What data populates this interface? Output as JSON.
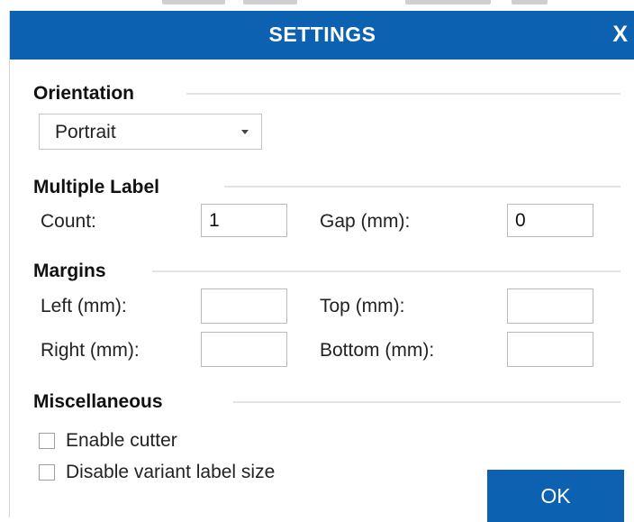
{
  "dialog": {
    "title": "SETTINGS",
    "close_label": "X",
    "accent_color": "#0c61b0"
  },
  "orientation": {
    "heading": "Orientation",
    "selected": "Portrait"
  },
  "multiple_label": {
    "heading": "Multiple Label",
    "count_label": "Count:",
    "count_value": "1",
    "gap_label": "Gap (mm):",
    "gap_value": "0"
  },
  "margins": {
    "heading": "Margins",
    "left_label": "Left (mm):",
    "left_value": "",
    "top_label": "Top (mm):",
    "top_value": "",
    "right_label": "Right (mm):",
    "right_value": "",
    "bottom_label": "Bottom (mm):",
    "bottom_value": ""
  },
  "misc": {
    "heading": "Miscellaneous",
    "enable_cutter_label": "Enable cutter",
    "enable_cutter_checked": false,
    "disable_variant_label": "Disable variant label size",
    "disable_variant_checked": false
  },
  "actions": {
    "ok_label": "OK"
  }
}
